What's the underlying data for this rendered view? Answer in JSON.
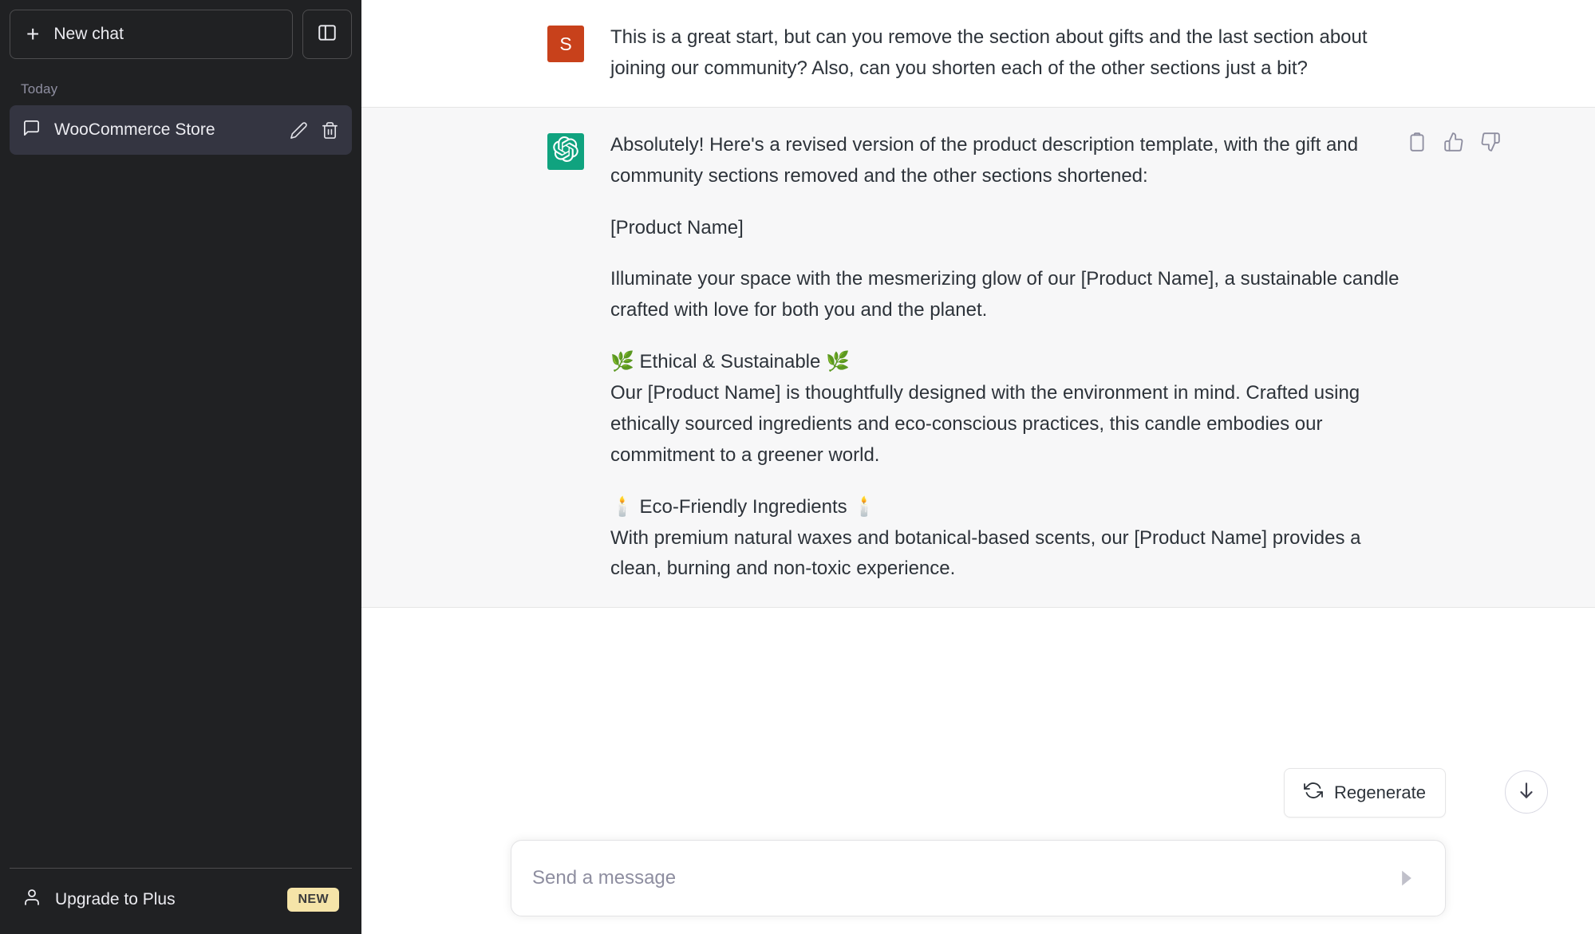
{
  "sidebar": {
    "new_chat_label": "New chat",
    "new_chat_icon": "plus-icon",
    "toggle_icon": "sidebar-toggle-icon",
    "section_label": "Today",
    "chats": [
      {
        "title": "WooCommerce Store",
        "icon": "chat-bubble-icon",
        "edit_icon": "pencil-icon",
        "delete_icon": "trash-icon",
        "active": true
      }
    ],
    "footer": {
      "upgrade_label": "Upgrade to Plus",
      "upgrade_icon": "person-icon",
      "badge": "NEW",
      "badge_color": "#f5e4a8"
    },
    "background_color": "#202123",
    "active_item_color": "#343541"
  },
  "conversation": {
    "messages": [
      {
        "role": "user",
        "avatar_initial": "S",
        "avatar_color": "#c8411b",
        "paragraphs": [
          "This is a great start, but can you remove the section about gifts and the last section about joining our community? Also, can you shorten each of the other sections just a bit?"
        ]
      },
      {
        "role": "assistant",
        "avatar_icon": "openai-logo-icon",
        "avatar_color": "#10a37f",
        "paragraphs": [
          "Absolutely! Here's a revised version of the product description template, with the gift and community sections removed and the other sections shortened:",
          "[Product Name]",
          "Illuminate your space with the mesmerizing glow of our [Product Name], a sustainable candle crafted with love for both you and the planet.",
          "🌿 Ethical & Sustainable 🌿",
          "Our [Product Name] is thoughtfully designed with the environment in mind. Crafted using ethically sourced ingredients and eco-conscious practices, this candle embodies our commitment to a greener world.",
          "🕯️ Eco-Friendly Ingredients 🕯️",
          "With premium natural waxes and botanical-based scents, our [Product Name] provides a clean, burning and non-toxic experience."
        ],
        "actions": [
          {
            "name": "copy-icon",
            "label": "Copy"
          },
          {
            "name": "thumbs-up-icon",
            "label": "Good response"
          },
          {
            "name": "thumbs-down-icon",
            "label": "Bad response"
          }
        ]
      }
    ]
  },
  "composer": {
    "placeholder": "Send a message",
    "value": "",
    "send_icon": "send-arrow-icon",
    "regenerate_label": "Regenerate",
    "regenerate_icon": "refresh-icon",
    "scroll_down_icon": "arrow-down-icon"
  }
}
